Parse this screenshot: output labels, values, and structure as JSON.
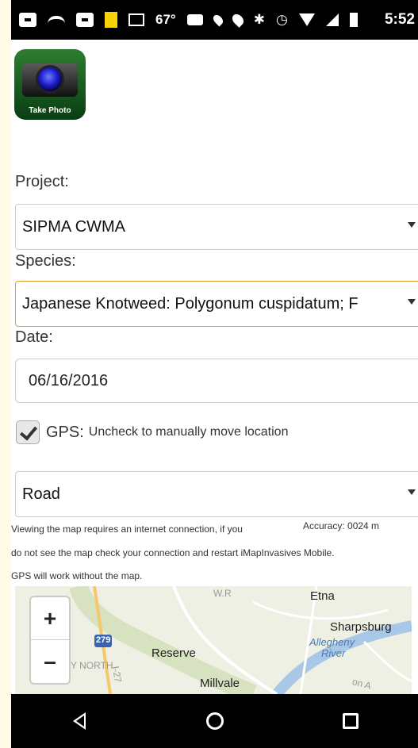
{
  "status_bar": {
    "temperature": "67°",
    "time": "5:52"
  },
  "photo_button": {
    "label": "Take Photo"
  },
  "form": {
    "project_label": "Project:",
    "project_value": "SIPMA CWMA",
    "species_label": "Species:",
    "species_value": "Japanese Knotweed: Polygonum cuspidatum; F",
    "date_label": "Date:",
    "date_value": "06/16/2016",
    "gps_label": "GPS:",
    "gps_hint": "Uncheck to manually move location",
    "gps_checked": true,
    "map_type_value": "Road"
  },
  "map_info": {
    "line1": "Viewing the map requires an internet connection, if you",
    "accuracy": "Accuracy: 0024 m",
    "line2": "do not see the map check your connection and restart iMapInvasives Mobile.",
    "line3": "GPS will work without the map."
  },
  "map": {
    "zoom_in": "+",
    "zoom_out": "–",
    "labels": {
      "etna": "Etna",
      "sharpsburg": "Sharpsburg",
      "allegheny": "Allegheny",
      "river": "River",
      "reserve": "Reserve",
      "millvale": "Millvale",
      "north": "Y NORTH",
      "route_279": "279",
      "route_wr": "W.R",
      "route_i": "I-27",
      "onav": "on A"
    }
  }
}
